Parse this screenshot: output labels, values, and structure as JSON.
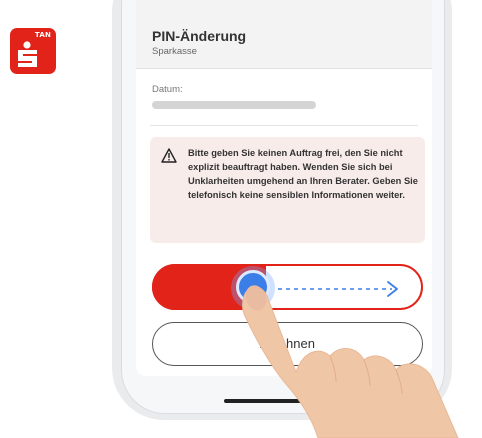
{
  "app": {
    "logo_text": "TAN",
    "icon": "sparkasse-tan-logo"
  },
  "header": {
    "title": "PIN-Änderung",
    "subtitle": "Sparkasse"
  },
  "details": {
    "date_label": "Datum:"
  },
  "warning": {
    "icon": "warning-triangle-icon",
    "text": "Bitte geben Sie keinen Auftrag frei, den Sie nicht explizit beauftragt haben. Wenden Sie sich bei Unklarheiten umgehend an Ihren Berater. Geben Sie telefonisch keine sensiblen Informationen weiter."
  },
  "actions": {
    "slider_icon": "slide-to-confirm-arrow-icon",
    "slider_progress": 0.38,
    "cancel_label": "Ablehnen"
  },
  "colors": {
    "brand": "#e2231a",
    "knob": "#3b7ee8",
    "warning_bg": "#f8ecea"
  }
}
